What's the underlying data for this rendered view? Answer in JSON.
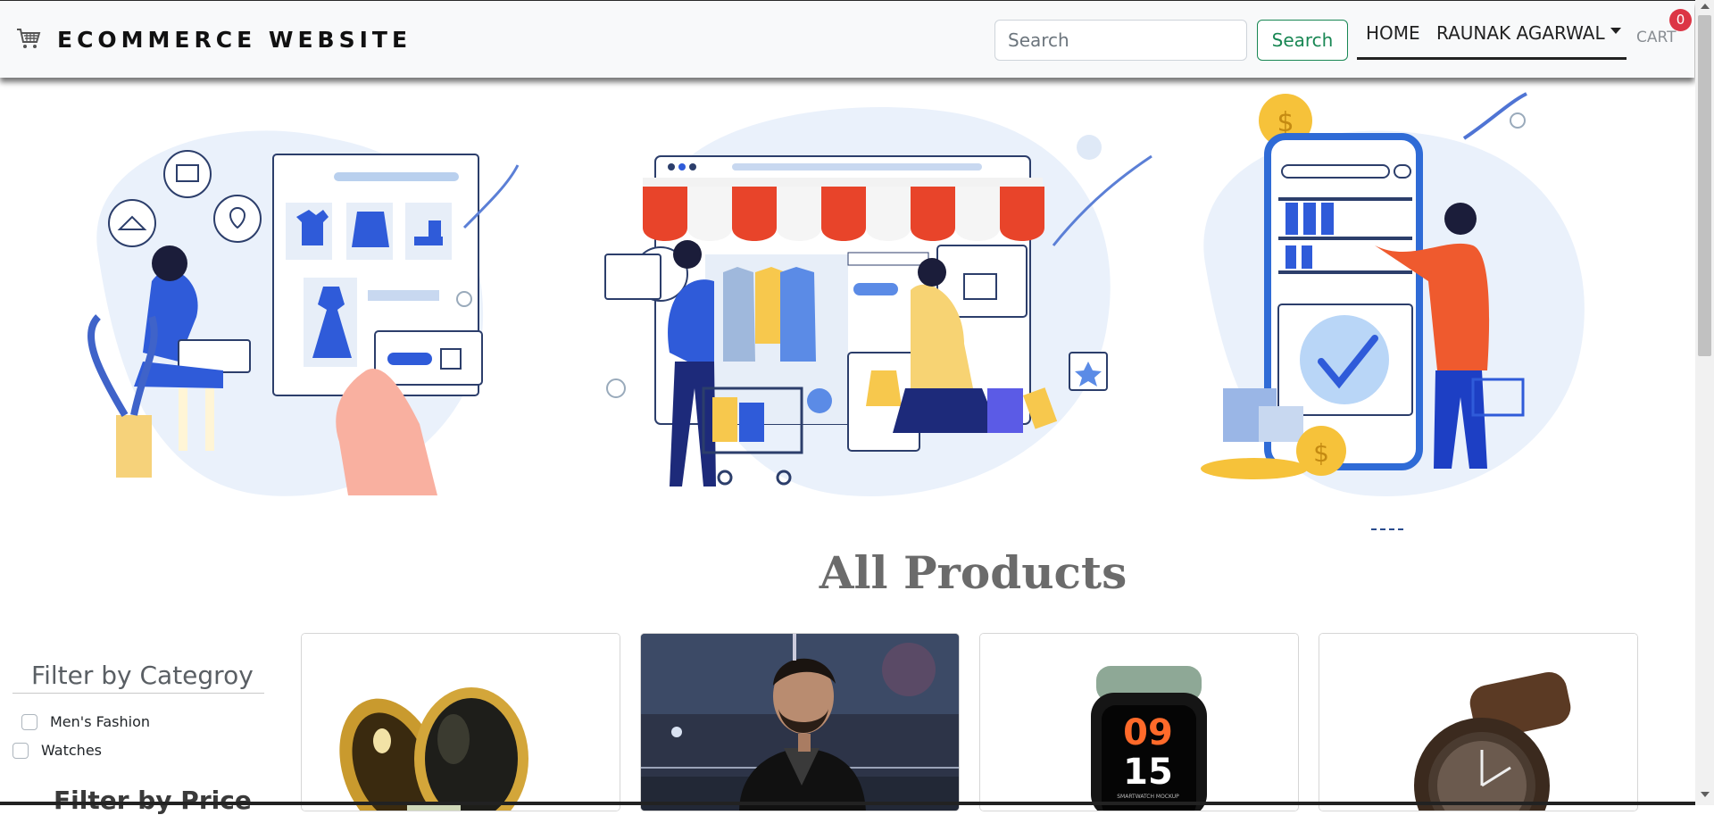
{
  "navbar": {
    "brand": "ECOMMERCE WEBSITE",
    "search_placeholder": "Search",
    "search_button": "Search",
    "home": "HOME",
    "user": "RAUNAK AGARWAL",
    "cart": "CART",
    "cart_count": "0"
  },
  "hero": {
    "illustrations": [
      "online-shopping-illustration",
      "storefront-shopping-illustration",
      "mobile-shopping-illustration"
    ]
  },
  "products_section": {
    "title": "All Products"
  },
  "filters": {
    "category_title": "Filter by Categroy",
    "categories": [
      "Men's Fashion",
      "Watches"
    ],
    "price_title": "Filter by Price"
  },
  "products": [
    {
      "image": "gold-pocket-watch-image"
    },
    {
      "image": "man-leather-jacket-image"
    },
    {
      "image": "smartwatch-mockup-image",
      "watch_time": [
        "09",
        "15"
      ],
      "watch_caption": "SMARTWATCH MOCKUP"
    },
    {
      "image": "brown-wristwatch-image"
    }
  ],
  "colors": {
    "accent_blue": "#2f5bd9",
    "success": "#198754",
    "badge": "#dc3545",
    "awning_red": "#e8442a"
  }
}
